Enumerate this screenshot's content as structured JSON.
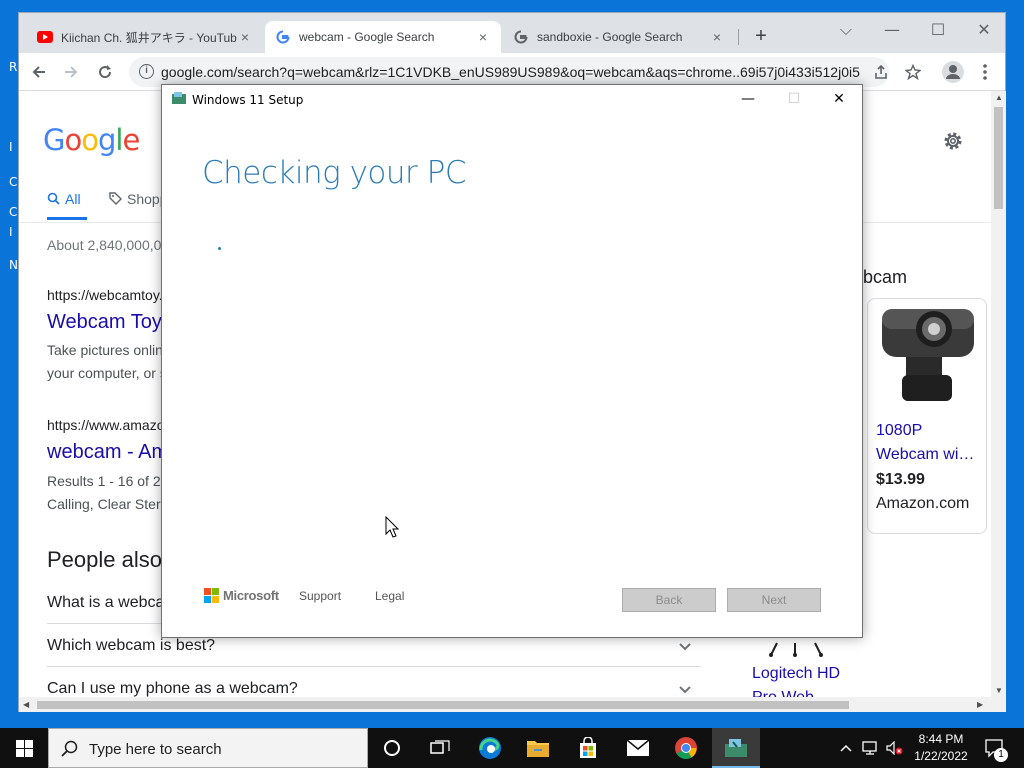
{
  "desktop": {
    "side_glyphs": [
      "R",
      "I",
      "C",
      "C",
      "I",
      "N"
    ]
  },
  "browser": {
    "tabs": [
      {
        "title": "Kiichan Ch. 狐井アキラ - YouTube",
        "favicon": "youtube-icon",
        "active": false
      },
      {
        "title": "webcam - Google Search",
        "favicon": "google-icon",
        "active": true
      },
      {
        "title": "sandboxie - Google Search",
        "favicon": "google-icon",
        "active": false
      }
    ],
    "close_glyph": "×",
    "new_tab_glyph": "+",
    "address": "google.com/search?q=webcam&rlz=1C1VDKB_enUS989US989&oq=webcam&aqs=chrome..69i57j0i433i512j0i5...",
    "window_controls": {
      "dropdown": "⌵",
      "minimize": "—",
      "maximize": "☐",
      "close": "✕"
    }
  },
  "google": {
    "logo": "Google",
    "tabs": {
      "all": "All",
      "shopping": "Shopp"
    },
    "stats": "About 2,840,000,0",
    "results": [
      {
        "url": "https://webcamtoy.",
        "title": "Webcam Toy",
        "snippet": [
          "Take pictures onlin",
          "your computer, or s"
        ]
      },
      {
        "url": "https://www.amazo",
        "title": "webcam - Am",
        "snippet": [
          "Results 1 - 16 of 2",
          "Calling, Clear Stere"
        ]
      }
    ],
    "people_also_ask": {
      "heading": "People also",
      "questions": [
        "What is a webca",
        "Which webcam is best?",
        "Can I use my phone as a webcam?"
      ]
    },
    "side_panel": {
      "title": "ebcam",
      "product": {
        "title": "1080P Webcam wi…",
        "price": "$13.99",
        "store": "Amazon.com"
      },
      "second_product_title_lines": [
        "Logitech HD",
        "Pro Web"
      ]
    }
  },
  "setup": {
    "window_title": "Windows 11 Setup",
    "heading": "Checking your PC",
    "controls": {
      "minimize": "—",
      "maximize": "☐",
      "close": "✕"
    },
    "footer": {
      "brand": "Microsoft",
      "links": [
        "Support",
        "Legal"
      ],
      "back": "Back",
      "next": "Next"
    }
  },
  "taskbar": {
    "search_placeholder": "Type here to search",
    "pinned": [
      "cortana-icon",
      "task-view-icon",
      "edge-icon",
      "file-explorer-icon",
      "store-icon",
      "mail-icon",
      "chrome-icon",
      "windows-setup-icon"
    ],
    "clock": {
      "time": "8:44 PM",
      "date": "1/22/2022"
    },
    "notification_count": "1"
  },
  "colors": {
    "desktop": "#0a74d8",
    "taskbar": "#101010",
    "setup_heading": "#2c7cb6",
    "link": "#1a0dab",
    "google_blue": "#4285f4",
    "google_red": "#ea4335",
    "google_yellow": "#fbbc05",
    "google_green": "#34a853"
  }
}
